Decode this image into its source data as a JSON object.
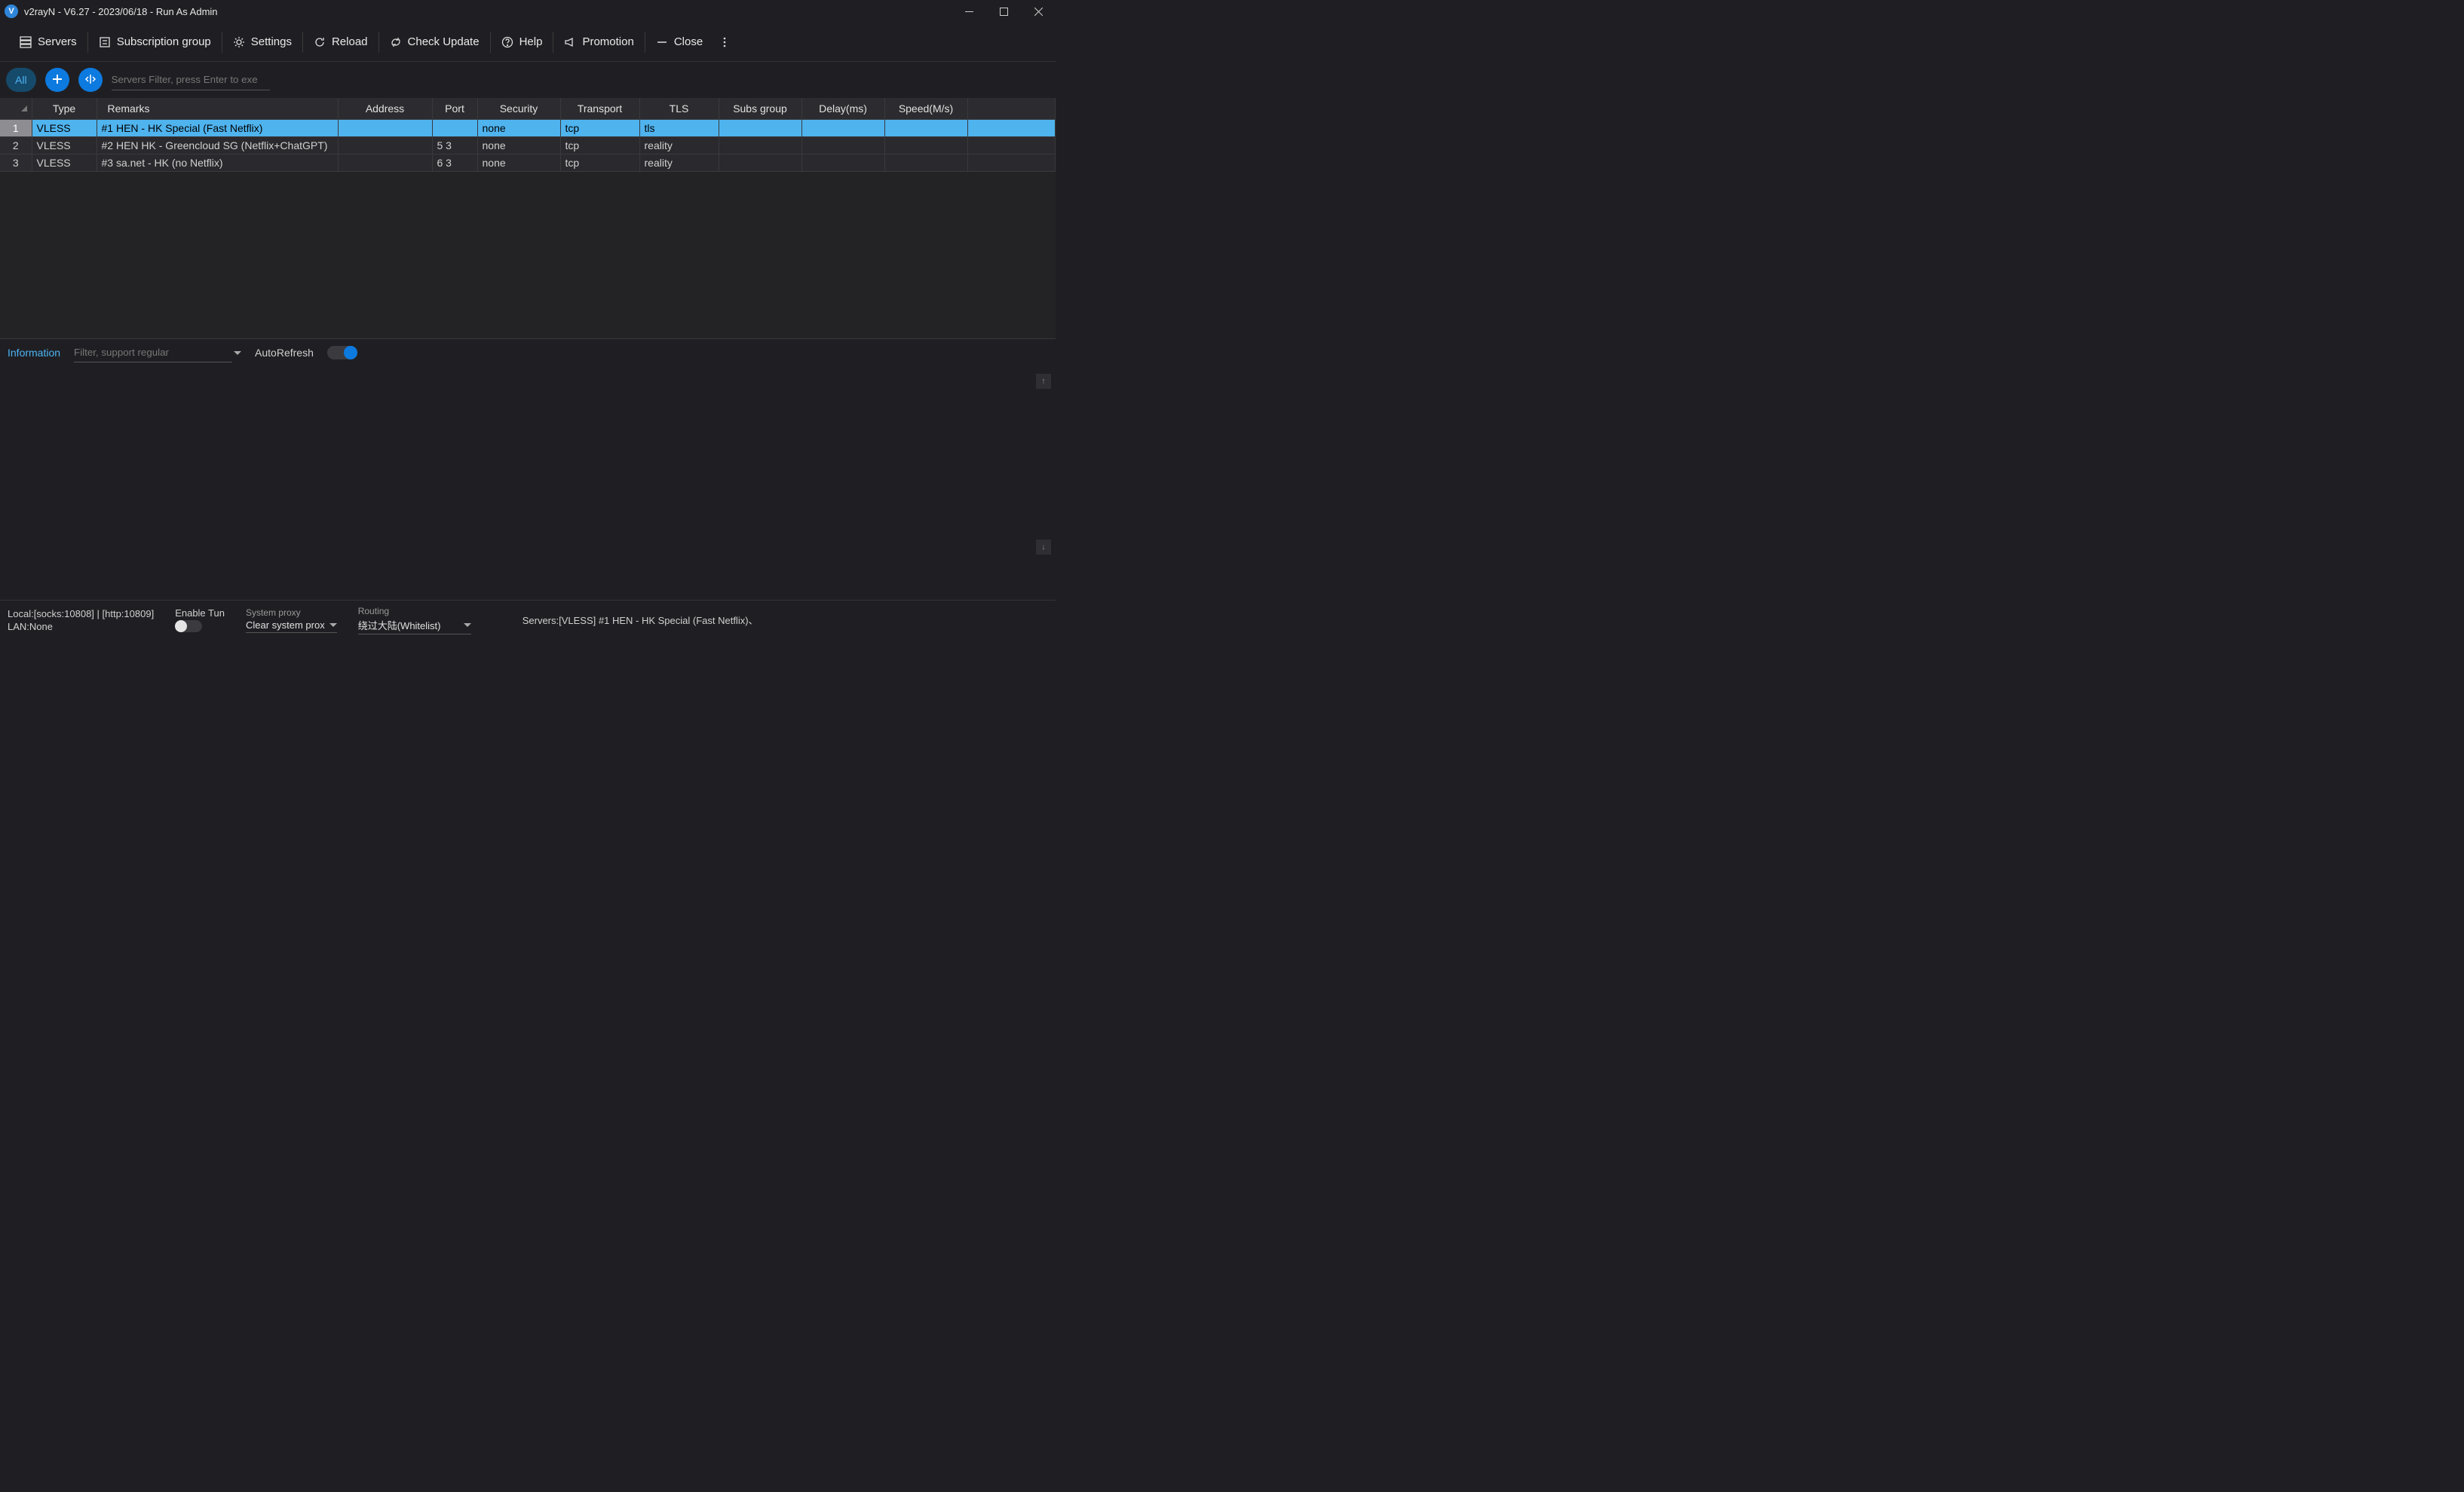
{
  "window": {
    "title": "v2rayN - V6.27 - 2023/06/18 - Run As Admin",
    "app_initial": "V"
  },
  "menu": {
    "servers": "Servers",
    "subscription": "Subscription group",
    "settings": "Settings",
    "reload": "Reload",
    "check_update": "Check Update",
    "help": "Help",
    "promotion": "Promotion",
    "close": "Close"
  },
  "filterbar": {
    "all_label": "All",
    "search_placeholder": "Servers Filter, press Enter to exe"
  },
  "table": {
    "headers": {
      "type": "Type",
      "remarks": "Remarks",
      "address": "Address",
      "port": "Port",
      "security": "Security",
      "transport": "Transport",
      "tls": "TLS",
      "subs_group": "Subs group",
      "delay": "Delay(ms)",
      "speed": "Speed(M/s)"
    },
    "rows": [
      {
        "num": "1",
        "type": "VLESS",
        "remarks": "#1 HEN - HK Special (Fast Netflix)",
        "address": "",
        "port": "",
        "security": "none",
        "transport": "tcp",
        "tls": "tls",
        "subs": "",
        "delay": "",
        "speed": "",
        "selected": true
      },
      {
        "num": "2",
        "type": "VLESS",
        "remarks": "#2 HEN HK - Greencloud SG (Netflix+ChatGPT)",
        "address": "",
        "port": "5   3",
        "security": "none",
        "transport": "tcp",
        "tls": "reality",
        "subs": "",
        "delay": "",
        "speed": ""
      },
      {
        "num": "3",
        "type": "VLESS",
        "remarks": "#3 sa.net - HK (no Netflix)",
        "address": "",
        "port": "6   3",
        "security": "none",
        "transport": "tcp",
        "tls": "reality",
        "subs": "",
        "delay": "",
        "speed": ""
      }
    ]
  },
  "info": {
    "label": "Information",
    "filter_placeholder": "Filter, support regular",
    "autorefresh_label": "AutoRefresh"
  },
  "status": {
    "local_line1": "Local:[socks:10808] | [http:10809]",
    "local_line2": "LAN:None",
    "enable_tun_label": "Enable Tun",
    "system_proxy_label": "System proxy",
    "system_proxy_value": "Clear system prox",
    "routing_label": "Routing",
    "routing_value": "绕过大陆(Whitelist)",
    "servers_line": "Servers:[VLESS] #1 HEN - HK Special (Fast Netflix)、"
  }
}
